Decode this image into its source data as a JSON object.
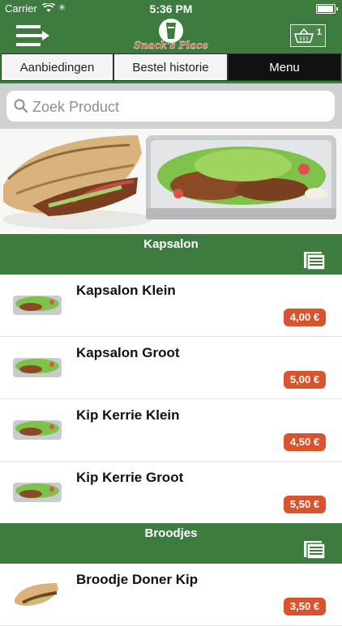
{
  "status_bar": {
    "carrier": "Carrier",
    "time": "5:36 PM",
    "battery_level": 0.95
  },
  "header": {
    "menu_icon": "menu-arrow-icon",
    "logo_text": "Snack's Place",
    "cart_icon": "basket-icon",
    "cart_count": "1"
  },
  "tabs": [
    {
      "label": "Aanbiedingen",
      "active": false
    },
    {
      "label": "Bestel historie",
      "active": false
    },
    {
      "label": "Menu",
      "active": true
    }
  ],
  "search": {
    "placeholder": "Zoek Product",
    "value": ""
  },
  "colors": {
    "brand_green": "#3e7b3f",
    "price_badge": "#d9542c",
    "active_tab": "#111111"
  },
  "sections": [
    {
      "title": "Kapsalon",
      "icon": "list-view-icon",
      "items": [
        {
          "name": "Kapsalon Klein",
          "price": "4,00 €"
        },
        {
          "name": "Kapsalon Groot",
          "price": "5,00 €"
        },
        {
          "name": "Kip Kerrie Klein",
          "price": "4,50 €"
        },
        {
          "name": "Kip Kerrie Groot",
          "price": "5,50 €"
        }
      ]
    },
    {
      "title": "Broodjes",
      "icon": "list-view-icon",
      "items": [
        {
          "name": "Broodje Doner Kip",
          "price": "3,50 €"
        }
      ]
    }
  ]
}
